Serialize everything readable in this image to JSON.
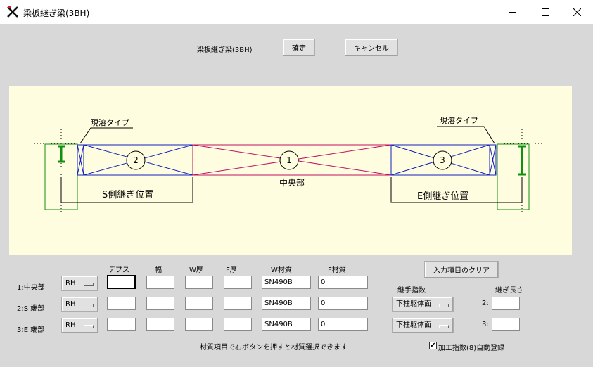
{
  "window": {
    "title": "梁板継ぎ梁(3BH)"
  },
  "header": {
    "label": "梁板継ぎ梁(3BH)",
    "confirm_label": "確定",
    "cancel_label": "キャンセル"
  },
  "drawing": {
    "left_weld_label": "現溶タイプ",
    "right_weld_label": "現溶タイプ",
    "center_label": "中央部",
    "s_splice_label": "S側継ぎ位置",
    "e_splice_label": "E側継ぎ位置",
    "segment_numbers": [
      "1",
      "2",
      "3"
    ]
  },
  "columns": {
    "depth": "デプス",
    "width": "幅",
    "w_thick": "W厚",
    "f_thick": "F厚",
    "w_material": "W材質",
    "f_material": "F材質"
  },
  "rows": [
    {
      "label": "1:中央部",
      "type": "RH",
      "depth": "",
      "width": "",
      "w_thick": "",
      "f_thick": "",
      "w_material": "SN490B",
      "f_material": "0"
    },
    {
      "label": "2:S 端部",
      "type": "RH",
      "depth": "",
      "width": "",
      "w_thick": "",
      "f_thick": "",
      "w_material": "SN490B",
      "f_material": "0"
    },
    {
      "label": "3:E 端部",
      "type": "RH",
      "depth": "",
      "width": "",
      "w_thick": "",
      "f_thick": "",
      "w_material": "SN490B",
      "f_material": "0"
    }
  ],
  "right_panel": {
    "clear_button": "入力項目のクリア",
    "joint_index_label": "継手指数",
    "joint_length_label": "継ぎ長さ",
    "joint_row2_value": "下柱躯体面",
    "joint_row3_value": "下柱躯体面",
    "length_row2_label": "2:",
    "length_row3_label": "3:",
    "length_row2_value": "",
    "length_row3_value": ""
  },
  "footer": {
    "hint": "材質項目で右ボタンを押すと材質選択できます",
    "auto_register_label": "加工指数(8)自動登録",
    "auto_register_checked": true
  }
}
